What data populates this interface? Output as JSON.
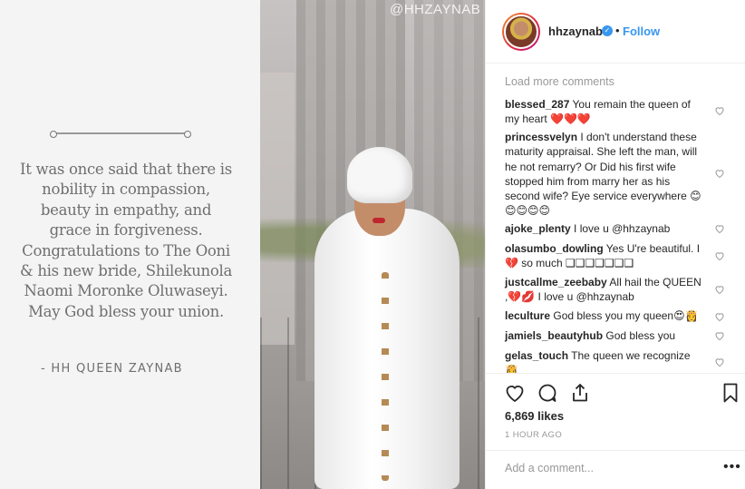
{
  "post_image": {
    "watermark": "@HHZAYNAB",
    "quote": "It was once said that there is nobility in compassion, beauty in empathy, and grace in forgiveness. Congratulations to The Ooni & his new bride, Shilekunola Naomi Moronke Oluwaseyi. May God bless your union.",
    "author": "- HH QUEEN ZAYNAB"
  },
  "header": {
    "username": "hhzaynab",
    "verified_mark": "✓",
    "separator": "•",
    "follow_label": "Follow"
  },
  "comments": {
    "load_more": "Load more comments",
    "items": [
      {
        "user": "blessed_287",
        "text": "You remain the queen of my heart ❤️❤️❤️"
      },
      {
        "user": "princessvelyn",
        "text": "I don't understand these maturity appraisal. She left the man, will he not remarry? Or Did his first wife stopped him from marry her as his second wife? Eye service everywhere 😊😊😊😊😊"
      },
      {
        "user": "ajoke_plenty",
        "text": "I love u @hhzaynab"
      },
      {
        "user": "olasumbo_dowling",
        "text": "Yes U're beautiful. I 💔 so much ❑❑❑❑❑❑❑"
      },
      {
        "user": "justcallme_zeebaby",
        "text": "All hail the QUEEN ,💔💋 I love u @hhzaynab"
      },
      {
        "user": "leculture",
        "text": "God bless you my queen😍👸"
      },
      {
        "user": "jamiels_beautyhub",
        "text": "God bless you"
      },
      {
        "user": "gelas_touch",
        "text": "The queen we recognize 👸"
      }
    ]
  },
  "actions": {
    "likes": "6,869 likes",
    "time": "1 HOUR AGO"
  },
  "add_comment": {
    "placeholder": "Add a comment...",
    "more_label": "•••"
  },
  "colors": {
    "link": "#3897f0",
    "text": "#262626",
    "muted": "#999999",
    "border": "#efefef"
  }
}
